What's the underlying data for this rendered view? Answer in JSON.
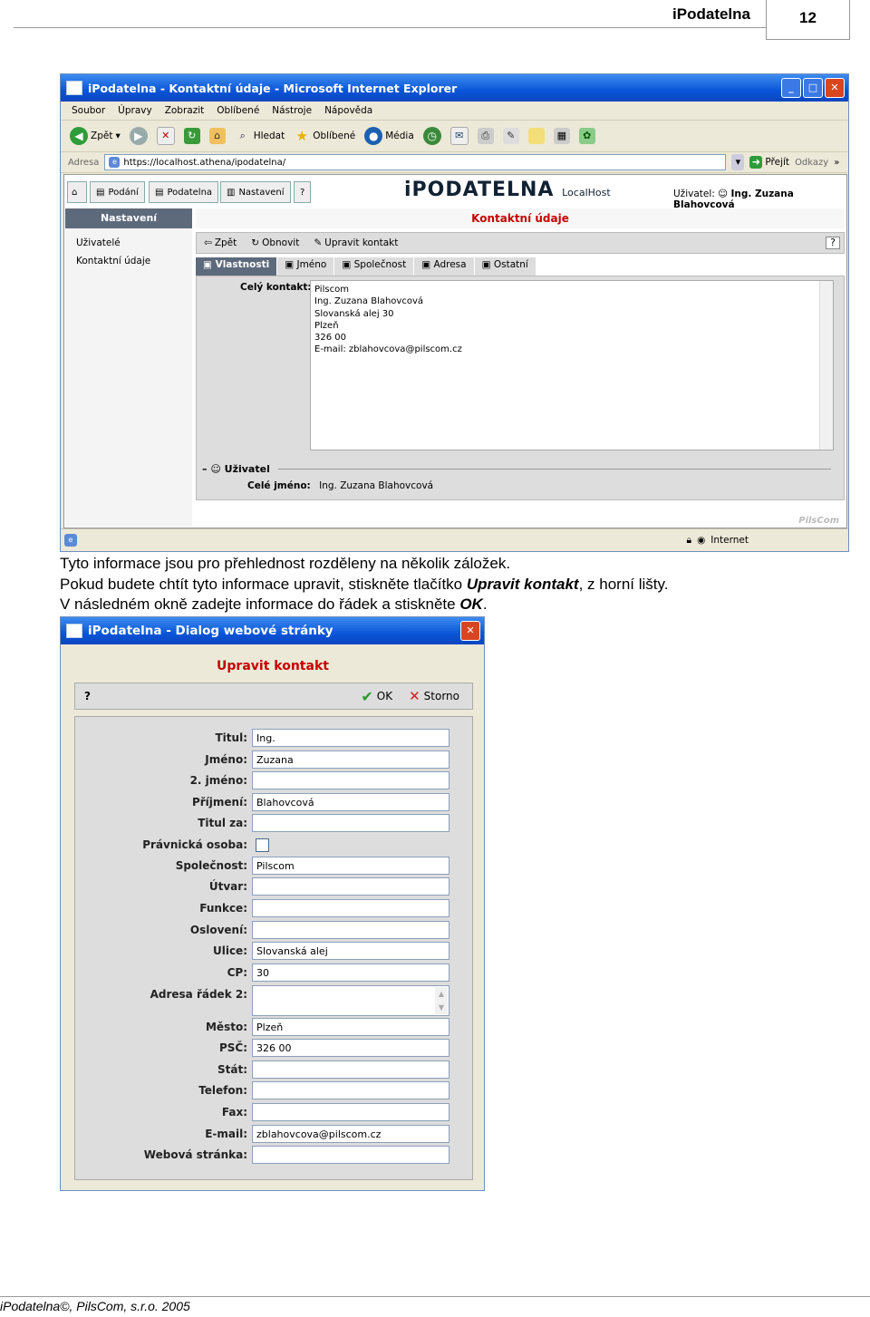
{
  "header": {
    "title": "iPodatelna",
    "page_number": "12"
  },
  "paragraphs": {
    "p1": "Tyto informace jsou pro přehlednost rozděleny na několik záložek.",
    "p2_pre": "Pokud budete chtít tyto informace upravit, stiskněte tlačítko ",
    "p2_bold": "Upravit kontakt",
    "p2_post": ", z horní lišty.",
    "p3_pre": "V následném okně zadejte informace do řádek a stiskněte ",
    "p3_bold": "OK",
    "p3_post": "."
  },
  "browser": {
    "title": "iPodatelna - Kontaktní údaje - Microsoft Internet Explorer",
    "menu": [
      "Soubor",
      "Úpravy",
      "Zobrazit",
      "Oblíbené",
      "Nástroje",
      "Nápověda"
    ],
    "toolbar": {
      "back": "Zpět",
      "search": "Hledat",
      "favorites": "Oblíbené",
      "media": "Média"
    },
    "address_label": "Adresa",
    "address": "https://localhost.athena/ipodatelna/",
    "go": "Přejít",
    "links": "Odkazy",
    "status_zone": "Internet"
  },
  "app": {
    "tabs": [
      "Podání",
      "Podatelna",
      "Nastavení",
      "?"
    ],
    "brand": "iPODATELNA",
    "brand_sub": "LocalHost",
    "user_label": "Uživatel:",
    "user_name": "Ing. Zuzana Blahovcová",
    "sidebar_head": "Nastavení",
    "sidebar_items": [
      "Uživatelé",
      "Kontaktní údaje"
    ],
    "main_title": "Kontaktní údaje",
    "actions": [
      "Zpět",
      "Obnovit",
      "Upravit kontakt"
    ],
    "property_tabs": [
      "Vlastnosti",
      "Jméno",
      "Společnost",
      "Adresa",
      "Ostatní"
    ],
    "full_contact_label": "Celý kontakt:",
    "full_contact_lines": [
      "Pilscom",
      "Ing. Zuzana Blahovcová",
      "Slovanská alej 30",
      "Plzeň",
      "326 00",
      "E-mail: zblahovcova@pilscom.cz"
    ],
    "user_section": "Uživatel",
    "full_name_label": "Celé jméno:",
    "full_name": "Ing. Zuzana Blahovcová",
    "watermark": "PilsCom"
  },
  "dialog": {
    "title": "iPodatelna - Dialog webové stránky",
    "heading": "Upravit kontakt",
    "help": "?",
    "ok": "OK",
    "cancel": "Storno",
    "fields": [
      {
        "label": "Titul:",
        "value": ""
      },
      {
        "label": "Jméno:",
        "value": ""
      },
      {
        "label": "2. jméno:",
        "value": ""
      },
      {
        "label": "Příjmení:",
        "value": ""
      },
      {
        "label": "Titul za:",
        "value": ""
      },
      {
        "label": "Právnická osoba:",
        "value": ""
      },
      {
        "label": "Společnost:",
        "value": ""
      },
      {
        "label": "Útvar:",
        "value": ""
      },
      {
        "label": "Funkce:",
        "value": ""
      },
      {
        "label": "Oslovení:",
        "value": ""
      },
      {
        "label": "Ulice:",
        "value": ""
      },
      {
        "label": "CP:",
        "value": ""
      },
      {
        "label": "Adresa řádek 2:",
        "value": ""
      },
      {
        "label": "Město:",
        "value": ""
      },
      {
        "label": "PSČ:",
        "value": ""
      },
      {
        "label": "Stát:",
        "value": ""
      },
      {
        "label": "Telefon:",
        "value": ""
      },
      {
        "label": "Fax:",
        "value": ""
      },
      {
        "label": "E-mail:",
        "value": ""
      },
      {
        "label": "Webová stránka:",
        "value": ""
      }
    ],
    "values": {
      "titul": "Ing.",
      "jmeno": "Zuzana",
      "prijmeni": "Blahovcová",
      "spolecnost": "Pilscom",
      "ulice": "Slovanská alej",
      "cp": "30",
      "mesto": "Plzeň",
      "psc": "326 00",
      "email": "zblahovcova@pilscom.cz"
    }
  },
  "footer": {
    "text": "iPodatelna©, PilsCom, s.r.o. 2005"
  }
}
